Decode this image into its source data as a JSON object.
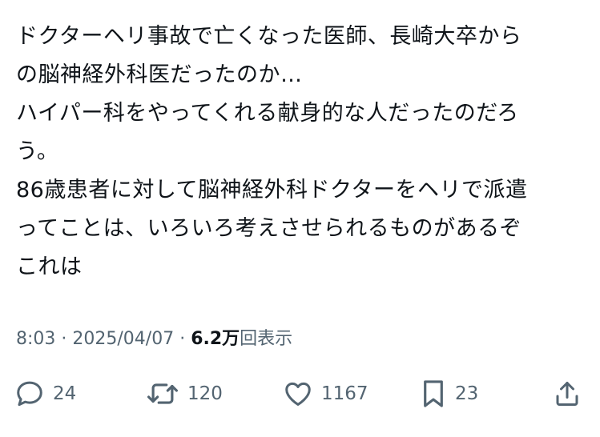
{
  "tweet": {
    "lines": [
      "ドクターヘリ事故で亡くなった医師、長崎大卒から",
      "の脳神経外科医だったのか…",
      "ハイパー科をやってくれる献身的な人だったのだろ",
      "う。",
      "86歳患者に対して脳神経外科ドクターをヘリで派遣",
      "ってことは、いろいろ考えさせられるものがあるぞ",
      "これは"
    ]
  },
  "meta": {
    "time": "8:03",
    "separator1": " · ",
    "date": "2025/04/07",
    "separator2": " · ",
    "views_count": "6.2万",
    "views_label": "回表示"
  },
  "actions": {
    "reply_count": "24",
    "retweet_count": "120",
    "like_count": "1167",
    "bookmark_count": "23"
  },
  "icons": {
    "reply": "speech-bubble-icon",
    "retweet": "retweet-arrows-icon",
    "like": "heart-icon",
    "bookmark": "bookmark-icon",
    "share": "share-upload-icon"
  },
  "colors": {
    "text": "#0f1419",
    "secondary": "#536471",
    "background": "#ffffff"
  }
}
